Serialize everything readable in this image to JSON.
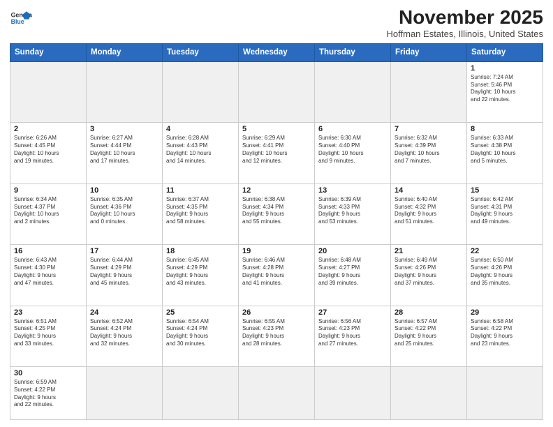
{
  "header": {
    "logo_general": "General",
    "logo_blue": "Blue",
    "month": "November 2025",
    "location": "Hoffman Estates, Illinois, United States"
  },
  "weekdays": [
    "Sunday",
    "Monday",
    "Tuesday",
    "Wednesday",
    "Thursday",
    "Friday",
    "Saturday"
  ],
  "weeks": [
    [
      {
        "day": "",
        "info": ""
      },
      {
        "day": "",
        "info": ""
      },
      {
        "day": "",
        "info": ""
      },
      {
        "day": "",
        "info": ""
      },
      {
        "day": "",
        "info": ""
      },
      {
        "day": "",
        "info": ""
      },
      {
        "day": "1",
        "info": "Sunrise: 7:24 AM\nSunset: 5:46 PM\nDaylight: 10 hours\nand 22 minutes."
      }
    ],
    [
      {
        "day": "2",
        "info": "Sunrise: 6:26 AM\nSunset: 4:45 PM\nDaylight: 10 hours\nand 19 minutes."
      },
      {
        "day": "3",
        "info": "Sunrise: 6:27 AM\nSunset: 4:44 PM\nDaylight: 10 hours\nand 17 minutes."
      },
      {
        "day": "4",
        "info": "Sunrise: 6:28 AM\nSunset: 4:43 PM\nDaylight: 10 hours\nand 14 minutes."
      },
      {
        "day": "5",
        "info": "Sunrise: 6:29 AM\nSunset: 4:41 PM\nDaylight: 10 hours\nand 12 minutes."
      },
      {
        "day": "6",
        "info": "Sunrise: 6:30 AM\nSunset: 4:40 PM\nDaylight: 10 hours\nand 9 minutes."
      },
      {
        "day": "7",
        "info": "Sunrise: 6:32 AM\nSunset: 4:39 PM\nDaylight: 10 hours\nand 7 minutes."
      },
      {
        "day": "8",
        "info": "Sunrise: 6:33 AM\nSunset: 4:38 PM\nDaylight: 10 hours\nand 5 minutes."
      }
    ],
    [
      {
        "day": "9",
        "info": "Sunrise: 6:34 AM\nSunset: 4:37 PM\nDaylight: 10 hours\nand 2 minutes."
      },
      {
        "day": "10",
        "info": "Sunrise: 6:35 AM\nSunset: 4:36 PM\nDaylight: 10 hours\nand 0 minutes."
      },
      {
        "day": "11",
        "info": "Sunrise: 6:37 AM\nSunset: 4:35 PM\nDaylight: 9 hours\nand 58 minutes."
      },
      {
        "day": "12",
        "info": "Sunrise: 6:38 AM\nSunset: 4:34 PM\nDaylight: 9 hours\nand 55 minutes."
      },
      {
        "day": "13",
        "info": "Sunrise: 6:39 AM\nSunset: 4:33 PM\nDaylight: 9 hours\nand 53 minutes."
      },
      {
        "day": "14",
        "info": "Sunrise: 6:40 AM\nSunset: 4:32 PM\nDaylight: 9 hours\nand 51 minutes."
      },
      {
        "day": "15",
        "info": "Sunrise: 6:42 AM\nSunset: 4:31 PM\nDaylight: 9 hours\nand 49 minutes."
      }
    ],
    [
      {
        "day": "16",
        "info": "Sunrise: 6:43 AM\nSunset: 4:30 PM\nDaylight: 9 hours\nand 47 minutes."
      },
      {
        "day": "17",
        "info": "Sunrise: 6:44 AM\nSunset: 4:29 PM\nDaylight: 9 hours\nand 45 minutes."
      },
      {
        "day": "18",
        "info": "Sunrise: 6:45 AM\nSunset: 4:29 PM\nDaylight: 9 hours\nand 43 minutes."
      },
      {
        "day": "19",
        "info": "Sunrise: 6:46 AM\nSunset: 4:28 PM\nDaylight: 9 hours\nand 41 minutes."
      },
      {
        "day": "20",
        "info": "Sunrise: 6:48 AM\nSunset: 4:27 PM\nDaylight: 9 hours\nand 39 minutes."
      },
      {
        "day": "21",
        "info": "Sunrise: 6:49 AM\nSunset: 4:26 PM\nDaylight: 9 hours\nand 37 minutes."
      },
      {
        "day": "22",
        "info": "Sunrise: 6:50 AM\nSunset: 4:26 PM\nDaylight: 9 hours\nand 35 minutes."
      }
    ],
    [
      {
        "day": "23",
        "info": "Sunrise: 6:51 AM\nSunset: 4:25 PM\nDaylight: 9 hours\nand 33 minutes."
      },
      {
        "day": "24",
        "info": "Sunrise: 6:52 AM\nSunset: 4:24 PM\nDaylight: 9 hours\nand 32 minutes."
      },
      {
        "day": "25",
        "info": "Sunrise: 6:54 AM\nSunset: 4:24 PM\nDaylight: 9 hours\nand 30 minutes."
      },
      {
        "day": "26",
        "info": "Sunrise: 6:55 AM\nSunset: 4:23 PM\nDaylight: 9 hours\nand 28 minutes."
      },
      {
        "day": "27",
        "info": "Sunrise: 6:56 AM\nSunset: 4:23 PM\nDaylight: 9 hours\nand 27 minutes."
      },
      {
        "day": "28",
        "info": "Sunrise: 6:57 AM\nSunset: 4:22 PM\nDaylight: 9 hours\nand 25 minutes."
      },
      {
        "day": "29",
        "info": "Sunrise: 6:58 AM\nSunset: 4:22 PM\nDaylight: 9 hours\nand 23 minutes."
      }
    ],
    [
      {
        "day": "30",
        "info": "Sunrise: 6:59 AM\nSunset: 4:22 PM\nDaylight: 9 hours\nand 22 minutes."
      },
      {
        "day": "",
        "info": ""
      },
      {
        "day": "",
        "info": ""
      },
      {
        "day": "",
        "info": ""
      },
      {
        "day": "",
        "info": ""
      },
      {
        "day": "",
        "info": ""
      },
      {
        "day": "",
        "info": ""
      }
    ]
  ]
}
